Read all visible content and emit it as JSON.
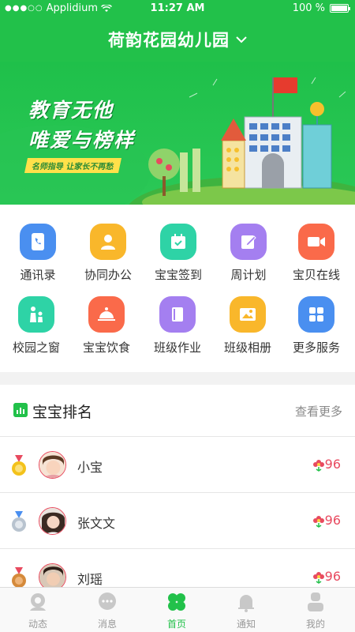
{
  "status": {
    "carrier": "Applidium",
    "signal_dots": "●●●○○",
    "time": "11:27 AM",
    "battery": "100 %"
  },
  "nav": {
    "title": "荷韵花园幼儿园"
  },
  "banner": {
    "slogan_line1": "教育无他",
    "slogan_line2": "唯爱与榜样",
    "tagline": "名师指导 让家长不再愁"
  },
  "menu": {
    "items": [
      {
        "label": "通讯录",
        "icon": "contacts-icon",
        "color": "#4a8ff0"
      },
      {
        "label": "协同办公",
        "icon": "office-person-icon",
        "color": "#f9b72b"
      },
      {
        "label": "宝宝签到",
        "icon": "calendar-check-icon",
        "color": "#2ed3a6"
      },
      {
        "label": "周计划",
        "icon": "edit-plan-icon",
        "color": "#a47ff0"
      },
      {
        "label": "宝贝在线",
        "icon": "video-camera-icon",
        "color": "#fa6a4a"
      },
      {
        "label": "校园之窗",
        "icon": "parent-child-icon",
        "color": "#2ed3a6"
      },
      {
        "label": "宝宝饮食",
        "icon": "food-cloche-icon",
        "color": "#fa6a4a"
      },
      {
        "label": "班级作业",
        "icon": "book-icon",
        "color": "#a47ff0"
      },
      {
        "label": "班级相册",
        "icon": "photo-album-icon",
        "color": "#f9b72b"
      },
      {
        "label": "更多服务",
        "icon": "grid-more-icon",
        "color": "#4a8ff0"
      }
    ]
  },
  "rank": {
    "title": "宝宝排名",
    "more": "查看更多",
    "rows": [
      {
        "name": "小宝",
        "score": "96",
        "medal": "gold-medal-icon"
      },
      {
        "name": "张文文",
        "score": "96",
        "medal": "silver-medal-icon"
      },
      {
        "name": "刘瑶",
        "score": "96",
        "medal": "bronze-medal-icon"
      }
    ]
  },
  "tabs": [
    {
      "label": "动态",
      "icon": "dynamic-icon",
      "active": false
    },
    {
      "label": "消息",
      "icon": "message-icon",
      "active": false
    },
    {
      "label": "首页",
      "icon": "clover-home-icon",
      "active": true
    },
    {
      "label": "通知",
      "icon": "bell-icon",
      "active": false
    },
    {
      "label": "我的",
      "icon": "profile-icon",
      "active": false
    }
  ],
  "colors": {
    "brand_green": "#22c14a",
    "score_red": "#e84a5f"
  }
}
